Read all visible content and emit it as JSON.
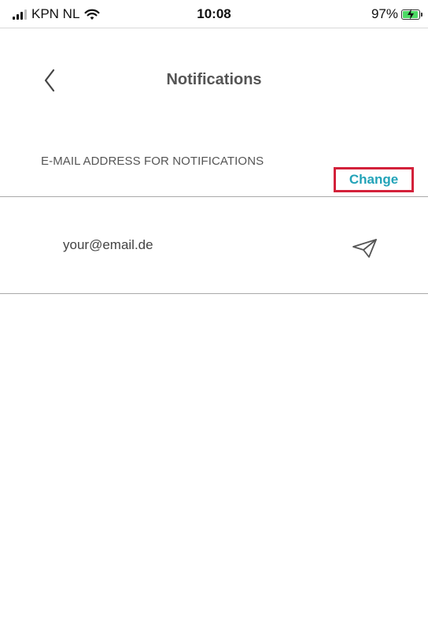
{
  "status_bar": {
    "carrier": "KPN NL",
    "time": "10:08",
    "battery_percent": "97%",
    "battery_level": 0.97,
    "battery_color": "#4cd964",
    "icons": [
      "signal-icon",
      "wifi-icon",
      "battery-charging-icon"
    ]
  },
  "header": {
    "title": "Notifications",
    "back_icon": "chevron-left-icon"
  },
  "section": {
    "label": "E-MAIL ADDRESS FOR NOTIFICATIONS",
    "change_label": "Change",
    "accent_color": "#23a3b8",
    "highlight_color": "#d3213a"
  },
  "email": {
    "value": "your@email.de",
    "send_icon": "paper-plane-icon"
  }
}
